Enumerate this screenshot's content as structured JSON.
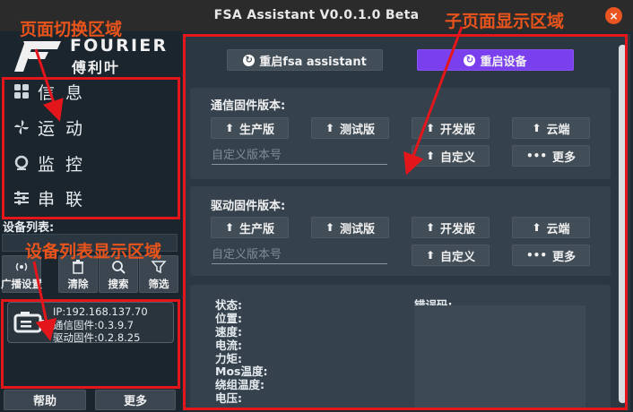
{
  "window": {
    "title": "FSA Assistant V0.0.1.0 Beta",
    "close_glyph": "×"
  },
  "brand": {
    "name": "FOURIER",
    "cn_name": "傅利叶"
  },
  "nav": {
    "items": [
      {
        "label": "信息",
        "icon": "grid-icon"
      },
      {
        "label": "运动",
        "icon": "fan-icon"
      },
      {
        "label": "监控",
        "icon": "monitor-icon"
      },
      {
        "label": "串联",
        "icon": "sliders-icon"
      }
    ]
  },
  "device_list": {
    "label": "设备列表:",
    "tools": [
      {
        "label": "广播设置",
        "icon": "broadcast-icon"
      },
      {
        "label": "清除",
        "icon": "trash-icon"
      },
      {
        "label": "搜索",
        "icon": "search-icon"
      },
      {
        "label": "筛选",
        "icon": "filter-icon"
      }
    ],
    "device": {
      "ip": "IP:192.168.137.70",
      "comm_fw": "通信固件:0.3.9.7",
      "drive_fw": "驱动固件:0.2.8.25"
    },
    "help_label": "帮助",
    "more_label": "更多"
  },
  "top_actions": {
    "restart_fsa": "重启fsa assistant",
    "restart_device": "重启设备"
  },
  "comm_fw_panel": {
    "title": "通信固件版本:",
    "buttons": [
      "生产版",
      "测试版",
      "开发版",
      "云端"
    ],
    "placeholder": "自定义版本号",
    "custom_label": "自定义",
    "more_label": "更多"
  },
  "drive_fw_panel": {
    "title": "驱动固件版本:",
    "buttons": [
      "生产版",
      "测试版",
      "开发版",
      "云端"
    ],
    "placeholder": "自定义版本号",
    "custom_label": "自定义",
    "more_label": "更多"
  },
  "status_panel": {
    "labels": [
      "状态:",
      "位置:",
      "速度:",
      "电流:",
      "力矩:",
      "Mos温度:",
      "绕组温度:",
      "电压:"
    ],
    "error_label": "错误码:"
  },
  "annotations": {
    "page_switch": "页面切换区域",
    "subpage": "子页面显示区域",
    "device_list_area": "设备列表显示区域"
  },
  "colors": {
    "accent_purple": "#7b40ee",
    "annotation_red": "#e3161c",
    "close_orange": "#e95420"
  }
}
